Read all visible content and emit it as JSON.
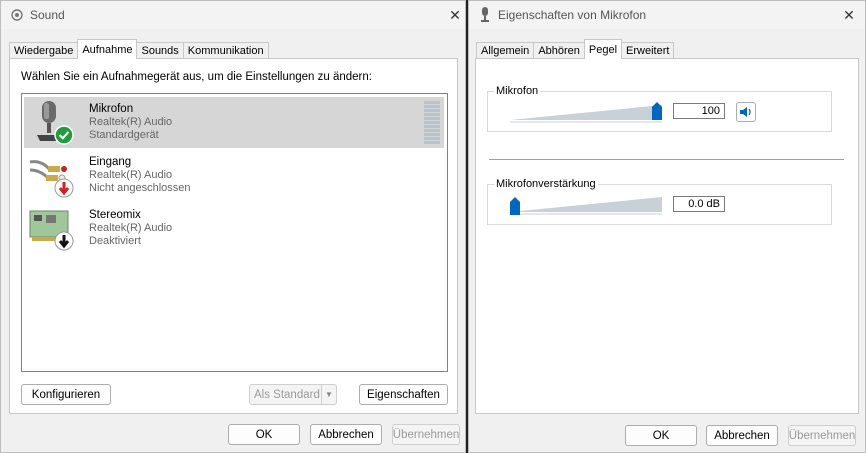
{
  "sound_window": {
    "title": "Sound",
    "tabs": [
      {
        "label": "Wiedergabe",
        "active": false
      },
      {
        "label": "Aufnahme",
        "active": true
      },
      {
        "label": "Sounds",
        "active": false
      },
      {
        "label": "Kommunikation",
        "active": false
      }
    ],
    "instruction": "Wählen Sie ein Aufnahmegerät aus, um die Einstellungen zu ändern:",
    "devices": [
      {
        "name": "Mikrofon",
        "driver": "Realtek(R) Audio",
        "status": "Standardgerät",
        "icon": "microphone-icon",
        "badge": "checkmark-badge-icon",
        "selected": true
      },
      {
        "name": "Eingang",
        "driver": "Realtek(R) Audio",
        "status": "Nicht angeschlossen",
        "icon": "audio-cable-icon",
        "badge": "red-down-arrow-badge-icon",
        "selected": false
      },
      {
        "name": "Stereomix",
        "driver": "Realtek(R) Audio",
        "status": "Deaktiviert",
        "icon": "sound-card-icon",
        "badge": "black-down-arrow-badge-icon",
        "selected": false
      }
    ],
    "buttons": {
      "configure": "Konfigurieren",
      "set_default": "Als Standard",
      "properties": "Eigenschaften",
      "ok": "OK",
      "cancel": "Abbrechen",
      "apply": "Übernehmen"
    }
  },
  "props_window": {
    "title": "Eigenschaften von Mikrofon",
    "tabs": [
      {
        "label": "Allgemein",
        "active": false
      },
      {
        "label": "Abhören",
        "active": false
      },
      {
        "label": "Pegel",
        "active": true
      },
      {
        "label": "Erweitert",
        "active": false
      }
    ],
    "microphone": {
      "label": "Mikrofon",
      "value_text": "100",
      "level": 1.0,
      "speaker_icon": "speaker-icon"
    },
    "boost": {
      "label": "Mikrofonverstärkung",
      "value_text": "0.0 dB",
      "level": 0.0
    },
    "buttons": {
      "ok": "OK",
      "cancel": "Abbrechen",
      "apply": "Übernehmen"
    }
  },
  "colors": {
    "accent": "#0067c0",
    "selection": "#d6d6d6",
    "check_green": "#1e9e3a",
    "arrow_red": "#d42020"
  }
}
